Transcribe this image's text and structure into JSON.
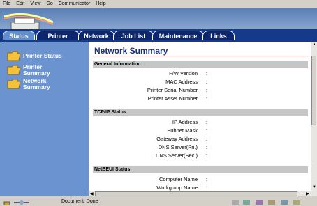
{
  "menu": [
    "File",
    "Edit",
    "View",
    "Go",
    "Communicator",
    "Help"
  ],
  "tabs": [
    {
      "label": "Status",
      "active": true
    },
    {
      "label": "Printer",
      "active": false
    },
    {
      "label": "Network",
      "active": false
    },
    {
      "label": "Job List",
      "active": false
    },
    {
      "label": "Maintenance",
      "active": false
    },
    {
      "label": "Links",
      "active": false
    }
  ],
  "nav": [
    {
      "label": "Printer Status"
    },
    {
      "label": "Printer Summary"
    },
    {
      "label": "Network Summary"
    }
  ],
  "page": {
    "title": "Network Summary",
    "sections": [
      {
        "title": "General Information",
        "rows": [
          "F/W Version",
          "MAC Address",
          "Printer Serial Number",
          "Printer Asset Number"
        ]
      },
      {
        "title": "TCP/IP Status",
        "rows": [
          "IP Address",
          "Subnet Mask",
          "Gateway Address",
          "DNS Server(Pri.)",
          "DNS Server(Sec.)"
        ]
      },
      {
        "title": "NetBEUI Status",
        "rows": [
          "Computer Name",
          "Workgroup Name"
        ]
      }
    ],
    "separator": ":"
  },
  "status": {
    "text": "Document: Done"
  },
  "colors": {
    "tab_bar": "#163a8a",
    "nav_bg": "#6b93cf",
    "title": "#1a2f7a",
    "rule": "#b22222"
  }
}
